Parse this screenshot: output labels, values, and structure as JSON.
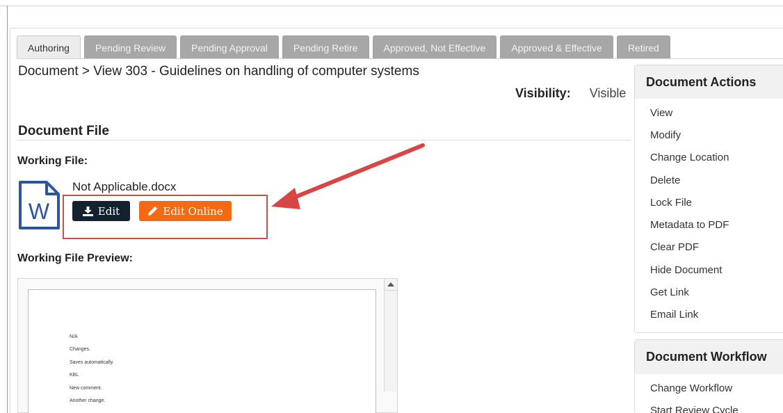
{
  "tabs": [
    {
      "label": "Authoring",
      "active": true
    },
    {
      "label": "Pending Review",
      "active": false
    },
    {
      "label": "Pending Approval",
      "active": false
    },
    {
      "label": "Pending Retire",
      "active": false
    },
    {
      "label": "Approved, Not Effective",
      "active": false
    },
    {
      "label": "Approved & Effective",
      "active": false
    },
    {
      "label": "Retired",
      "active": false
    }
  ],
  "breadcrumb": "Document > View 303 - Guidelines on handling of computer systems",
  "visibility": {
    "label": "Visibility:",
    "value": "Visible"
  },
  "document_file": {
    "title": "Document File",
    "working_file_label": "Working File:",
    "file_name": "Not Applicable.docx",
    "edit_button": "Edit",
    "edit_online_button": "Edit Online",
    "preview_label": "Working File Preview:",
    "preview_lines": [
      "N/A",
      "Changes.",
      "Saves automatically.",
      "KBL",
      "New comment.",
      "Another change."
    ]
  },
  "document_actions": {
    "title": "Document Actions",
    "items": [
      "View",
      "Modify",
      "Change Location",
      "Delete",
      "Lock File",
      "Metadata to PDF",
      "Clear PDF",
      "Hide Document",
      "Get Link",
      "Email Link"
    ]
  },
  "document_workflow": {
    "title": "Document Workflow",
    "items": [
      "Change Workflow",
      "Start Review Cycle"
    ]
  },
  "colors": {
    "tab_inactive": "#a7a7a7",
    "edit_button": "#14222f",
    "edit_online_button": "#f36a12",
    "annotation_red": "#d44a4a",
    "word_blue": "#2b5797"
  },
  "icons": [
    "word-document-icon",
    "download-icon",
    "pencil-icon",
    "scroll-up-arrow-icon"
  ]
}
